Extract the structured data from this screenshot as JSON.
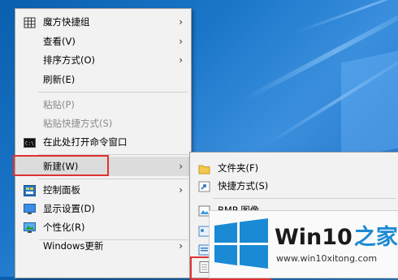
{
  "main_menu": {
    "items": [
      {
        "label": "魔方快捷组",
        "icon": "grid-icon",
        "arrow": "›"
      },
      {
        "label": "查看(V)",
        "arrow": "›"
      },
      {
        "label": "排序方式(O)",
        "arrow": "›"
      },
      {
        "label": "刷新(E)"
      },
      {
        "label": "粘贴(P)",
        "disabled": true
      },
      {
        "label": "粘贴快捷方式(S)",
        "disabled": true
      },
      {
        "label": "在此处打开命令窗口",
        "icon": "cmd-icon"
      },
      {
        "label": "新建(W)",
        "arrow": "›"
      },
      {
        "label": "控制面板",
        "icon": "control-panel-icon",
        "arrow": "›"
      },
      {
        "label": "显示设置(D)",
        "icon": "display-icon"
      },
      {
        "label": "个性化(R)",
        "icon": "personalize-icon"
      },
      {
        "label": "Windows更新",
        "arrow": "›"
      }
    ]
  },
  "sub_menu": {
    "items": [
      {
        "label": "文件夹(F)",
        "icon": "folder-icon"
      },
      {
        "label": "快捷方式(S)",
        "icon": "shortcut-icon"
      },
      {
        "label": "BMP 图像",
        "icon": "bmp-icon"
      }
    ]
  },
  "watermark": {
    "brand": "Win10",
    "brand_suffix": "之家",
    "url": "www.win10xitong.com"
  },
  "colors": {
    "highlight_border": "#e0312f",
    "desktop_blue": "#1b76c9",
    "logo_blue": "#1a8ad4"
  }
}
